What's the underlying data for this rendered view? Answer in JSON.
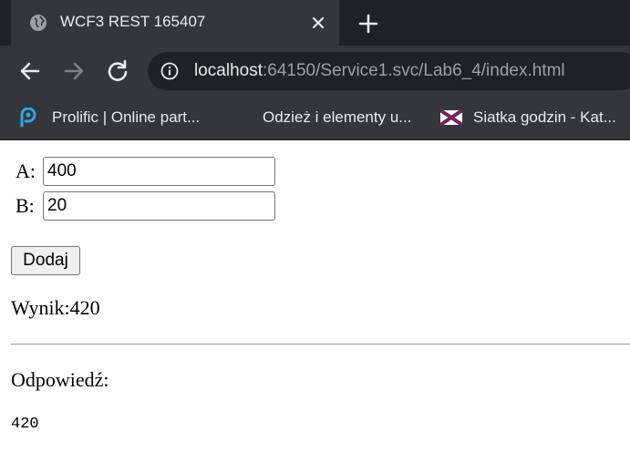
{
  "browser": {
    "tab": {
      "title": "WCF3 REST 165407",
      "favicon": "globe-icon"
    },
    "omnibox": {
      "host": "localhost",
      "rest": ":64150/Service1.svc/Lab6_4/index.html"
    },
    "bookmarks": [
      {
        "label": "Prolific | Online part...",
        "icon": "prolific-logo-icon"
      },
      {
        "label": "Odzież i elementy u...",
        "icon": ""
      },
      {
        "label": "Siatka godzin - Kat...",
        "icon": "flag-icon"
      }
    ]
  },
  "page": {
    "field_a": {
      "label": "A:",
      "value": "400"
    },
    "field_b": {
      "label": "B:",
      "value": "20"
    },
    "add_button": "Dodaj",
    "result_text": "Wynik:420",
    "answer_label": "Odpowiedź:",
    "answer_value": "420"
  }
}
